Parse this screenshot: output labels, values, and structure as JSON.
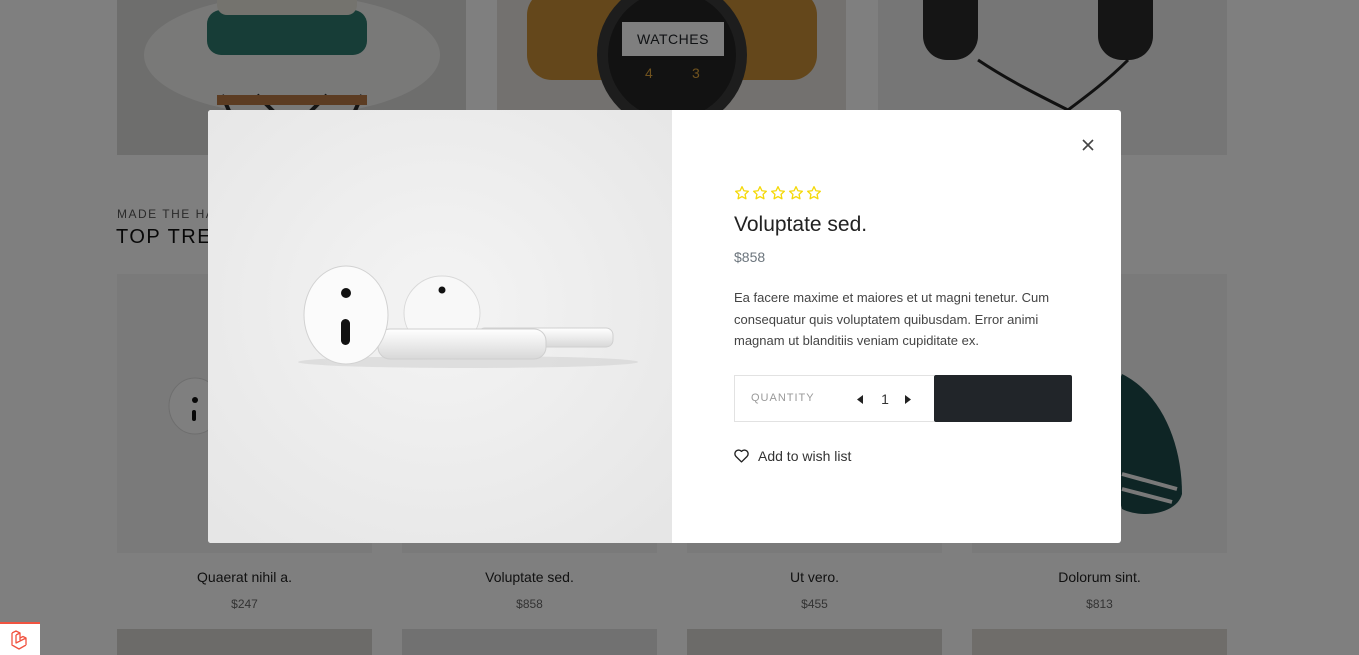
{
  "categories": [
    {
      "label": ""
    },
    {
      "label": "WATCHES"
    },
    {
      "label": ""
    }
  ],
  "section": {
    "subtitle": "MADE THE HA",
    "title": "TOP TREN"
  },
  "products": [
    {
      "name": "Quaerat nihil a.",
      "price": "$247"
    },
    {
      "name": "Voluptate sed.",
      "price": "$858"
    },
    {
      "name": "Ut vero.",
      "price": "$455"
    },
    {
      "name": "Dolorum sint.",
      "price": "$813"
    }
  ],
  "modal": {
    "rating": 0,
    "rating_max": 5,
    "title": "Voluptate sed.",
    "price": "$858",
    "description": "Ea facere maxime et maiores et ut magni tenetur. Cum consequatur quis voluptatem quibusdam. Error animi magnam ut blanditiis veniam cupiditate ex.",
    "quantity_label": "QUANTITY",
    "quantity": "1",
    "add_to_cart_label": "",
    "wishlist_label": "Add to wish list"
  },
  "colors": {
    "star": "#f5d90a",
    "button_dark": "#212529",
    "laravel_red": "#f05340"
  },
  "icons": {
    "close": "close-icon",
    "star": "star-outline-icon",
    "decrement": "caret-left-icon",
    "increment": "caret-right-icon",
    "wishlist": "heart-outline-icon",
    "debugbar": "laravel-logo-icon"
  }
}
